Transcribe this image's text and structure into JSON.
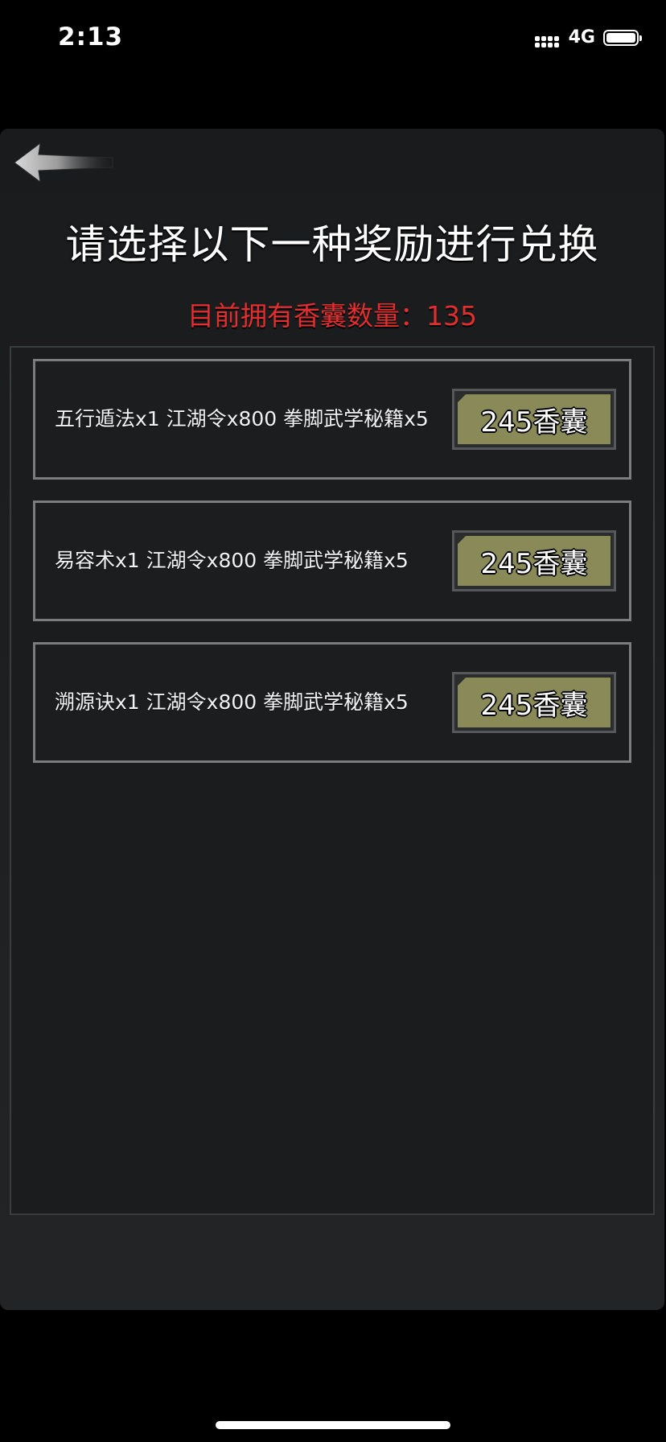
{
  "status_bar": {
    "time": "2:13",
    "network": "4G"
  },
  "header": {
    "title": "请选择以下一种奖励进行兑换",
    "currency_text": "目前拥有香囊数量：135"
  },
  "rewards": [
    {
      "description": "五行遁法x1 江湖令x800 拳脚武学秘籍x5",
      "price": "245香囊"
    },
    {
      "description": "易容术x1 江湖令x800 拳脚武学秘籍x5",
      "price": "245香囊"
    },
    {
      "description": "溯源诀x1 江湖令x800 拳脚武学秘籍x5",
      "price": "245香囊"
    }
  ],
  "icons": {
    "back": "back-arrow-icon",
    "signal": "signal-icon",
    "battery": "battery-icon"
  },
  "colors": {
    "currency_text": "#e12f2f",
    "price_button_fill": "#8a8a58",
    "card_border": "#7a7c7e"
  }
}
